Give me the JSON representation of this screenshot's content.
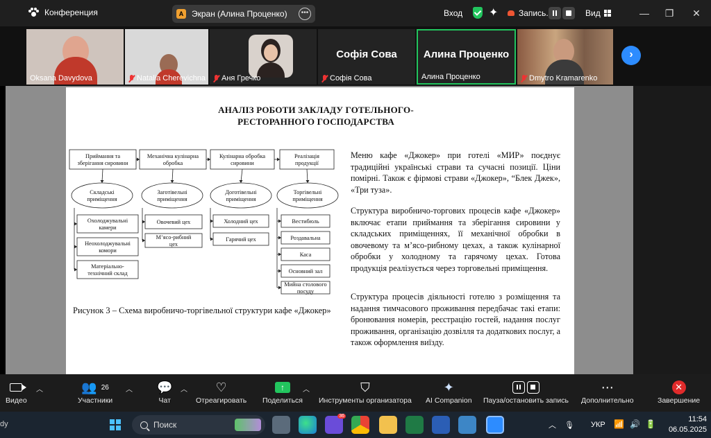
{
  "titlebar": {
    "app_name": "Конференция",
    "share_badge": "A",
    "share_label": "Экран (Алина Проценко)",
    "login": "Вход",
    "record_label": "Запись...",
    "view_label": "Вид"
  },
  "participants": [
    {
      "name": "Oksana Davydova",
      "muted": false
    },
    {
      "name": "Natalia Cherevichna",
      "muted": true
    },
    {
      "name": "Аня Гречко",
      "muted": true
    },
    {
      "name": "Софія Сова",
      "display": "Софія Сова",
      "muted": true
    },
    {
      "name": "Алина Проценко",
      "display": "Алина Проценко",
      "muted": false,
      "active": true
    },
    {
      "name": "Dmytro Kramarenko",
      "muted": true
    }
  ],
  "document": {
    "title": "АНАЛІЗ РОБОТИ ЗАКЛАДУ ГОТЕЛЬНОГО-\nРЕСТОРАННОГО ГОСПОДАРСТВА",
    "caption": "Рисунок 3 – Схема виробничо-торгівельної структури кафе «Джокер»",
    "paragraphs": [
      "Меню кафе «Джокер» при готелі «МИР» поєднує традиційні українські страви та сучасні позиції. Ціни помірні. Також є фірмові страви «Джокер», “Блек Джек», «Три туза».",
      "Структура виробничо-торгових процесів кафе «Джокер» включає етапи приймання та зберігання сировини у складських приміщеннях, її механічної обробки в овочевому та м’ясо-рибному цехах, а також кулінарної обробки у холодному та гарячому цехах. Готова продукція реалізується через торговельні приміщення.",
      "Структура процесів діяльності готелю з розміщення та надання тимчасового проживання передбачає такі етапи: бронювання номерів, реєстрацію гостей, надання послуг проживання, організацію дозвілля та додаткових послуг, а також оформлення виїзду."
    ],
    "diagram": {
      "stages": [
        [
          "Приймання та",
          "зберігання сировини"
        ],
        [
          "Механічна кулінарна",
          "обробка"
        ],
        [
          "Кулінарна обробка",
          "сировини"
        ],
        [
          "Реалізація",
          "продукції"
        ]
      ],
      "groups": [
        [
          "Складські",
          "приміщення"
        ],
        [
          "Заготівельні",
          "приміщення"
        ],
        [
          "Доготівельні",
          "приміщення"
        ],
        [
          "Торгівельні",
          "приміщення"
        ]
      ],
      "storage": [
        [
          "Охолоджувальні",
          "камери"
        ],
        [
          "Неохолоджувальні",
          "комори"
        ],
        [
          "Матеріально-",
          "технічний склад"
        ]
      ],
      "prep": [
        [
          "Овочевий цех"
        ],
        [
          "М’ясо-рибний",
          "цех"
        ]
      ],
      "cooking": [
        [
          "Холодний цех"
        ],
        [
          "Гарячий цех"
        ]
      ],
      "trade": [
        [
          "Вестибюль"
        ],
        [
          "Роздавальна"
        ],
        [
          "Каса"
        ],
        [
          "Основний зал"
        ],
        [
          "Мийна столового",
          "посуду"
        ]
      ]
    }
  },
  "toolbar": {
    "video": "Видео",
    "participants": "Участники",
    "participants_count": "26",
    "chat": "Чат",
    "react": "Отреагировать",
    "share": "Поделиться",
    "host_tools": "Инструменты организатора",
    "ai": "AI Companion",
    "pause_record": "Пауза/остановить запись",
    "more": "Дополнительно",
    "end": "Завершение"
  },
  "taskbar": {
    "edge_text": "dy",
    "search_placeholder": "Поиск",
    "browser_badge": "36",
    "lang": "УКР",
    "time": "11:54",
    "date": "06.05.2025"
  },
  "colors": {
    "accent_blue": "#2d8cff",
    "active_border": "#22c55e",
    "end_red": "#e02b2b",
    "toolbar_bg": "#1c1c1c"
  }
}
